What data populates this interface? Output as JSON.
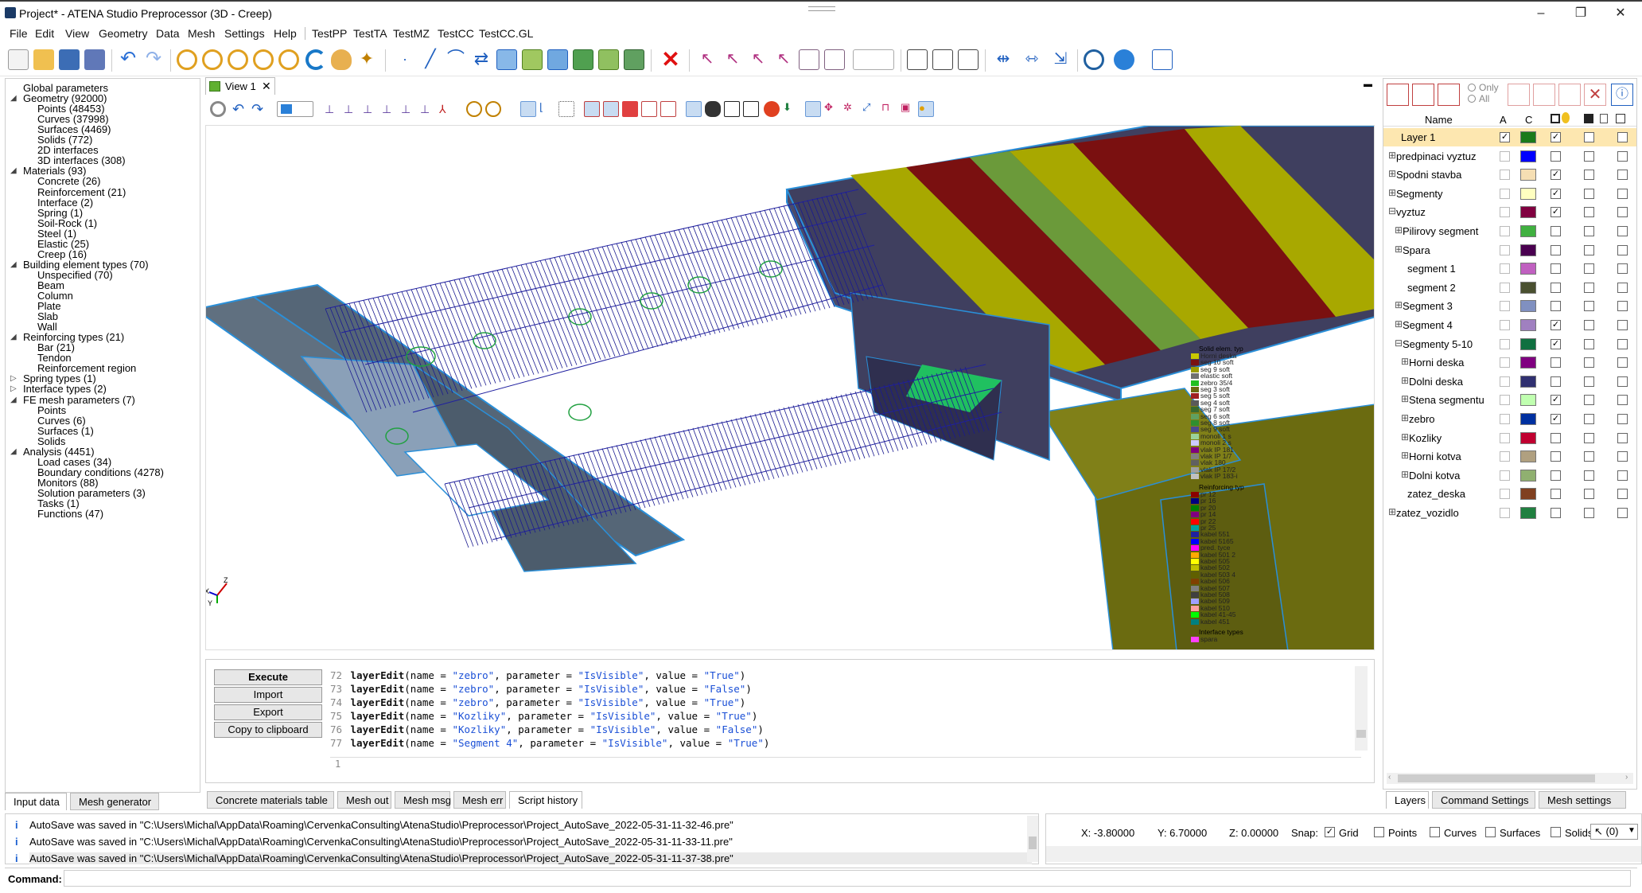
{
  "window": {
    "title": "Project* - ATENA Studio Preprocessor (3D - Creep)",
    "minimize": "–",
    "maximize": "❐",
    "close": "✕"
  },
  "menu": [
    "File",
    "Edit",
    "View",
    "Geometry",
    "Data",
    "Mesh",
    "Settings",
    "Help",
    "TestPP",
    "TestTA",
    "TestMZ",
    "TestCC",
    "TestCC.GL"
  ],
  "tree": [
    {
      "label": "Global parameters",
      "level": 0,
      "toggle": ""
    },
    {
      "label": "Geometry (92000)",
      "level": 0,
      "toggle": "◢"
    },
    {
      "label": "Points (48453)",
      "level": 1,
      "toggle": ""
    },
    {
      "label": "Curves (37998)",
      "level": 1,
      "toggle": ""
    },
    {
      "label": "Surfaces (4469)",
      "level": 1,
      "toggle": ""
    },
    {
      "label": "Solids (772)",
      "level": 1,
      "toggle": ""
    },
    {
      "label": "2D interfaces",
      "level": 1,
      "toggle": ""
    },
    {
      "label": "3D interfaces (308)",
      "level": 1,
      "toggle": ""
    },
    {
      "label": "Materials (93)",
      "level": 0,
      "toggle": "◢"
    },
    {
      "label": "Concrete (26)",
      "level": 1,
      "toggle": ""
    },
    {
      "label": "Reinforcement (21)",
      "level": 1,
      "toggle": ""
    },
    {
      "label": "Interface (2)",
      "level": 1,
      "toggle": ""
    },
    {
      "label": "Spring (1)",
      "level": 1,
      "toggle": ""
    },
    {
      "label": "Soil-Rock (1)",
      "level": 1,
      "toggle": ""
    },
    {
      "label": "Steel (1)",
      "level": 1,
      "toggle": ""
    },
    {
      "label": "Elastic (25)",
      "level": 1,
      "toggle": ""
    },
    {
      "label": "Creep (16)",
      "level": 1,
      "toggle": ""
    },
    {
      "label": "Building element types (70)",
      "level": 0,
      "toggle": "◢"
    },
    {
      "label": "Unspecified  (70)",
      "level": 1,
      "toggle": ""
    },
    {
      "label": "Beam",
      "level": 1,
      "toggle": ""
    },
    {
      "label": "Column",
      "level": 1,
      "toggle": ""
    },
    {
      "label": "Plate",
      "level": 1,
      "toggle": ""
    },
    {
      "label": "Slab",
      "level": 1,
      "toggle": ""
    },
    {
      "label": "Wall",
      "level": 1,
      "toggle": ""
    },
    {
      "label": "Reinforcing types  (21)",
      "level": 0,
      "toggle": "◢"
    },
    {
      "label": "Bar  (21)",
      "level": 1,
      "toggle": ""
    },
    {
      "label": "Tendon",
      "level": 1,
      "toggle": ""
    },
    {
      "label": "Reinforcement region",
      "level": 1,
      "toggle": ""
    },
    {
      "label": "Spring types  (1)",
      "level": 0,
      "toggle": "▷"
    },
    {
      "label": "Interface types  (2)",
      "level": 0,
      "toggle": "▷"
    },
    {
      "label": "FE mesh parameters (7)",
      "level": 0,
      "toggle": "◢"
    },
    {
      "label": "Points",
      "level": 1,
      "toggle": ""
    },
    {
      "label": "Curves (6)",
      "level": 1,
      "toggle": ""
    },
    {
      "label": "Surfaces (1)",
      "level": 1,
      "toggle": ""
    },
    {
      "label": "Solids",
      "level": 1,
      "toggle": ""
    },
    {
      "label": "Analysis (4451)",
      "level": 0,
      "toggle": "◢"
    },
    {
      "label": "Load cases (34)",
      "level": 1,
      "toggle": ""
    },
    {
      "label": "Boundary conditions (4278)",
      "level": 1,
      "toggle": ""
    },
    {
      "label": "Monitors (88)",
      "level": 1,
      "toggle": ""
    },
    {
      "label": "Solution parameters (3)",
      "level": 1,
      "toggle": ""
    },
    {
      "label": "Tasks (1)",
      "level": 1,
      "toggle": ""
    },
    {
      "label": "Functions (47)",
      "level": 1,
      "toggle": ""
    }
  ],
  "left_tabs": [
    "Input data",
    "Mesh generator"
  ],
  "view_tab": {
    "label": "View 1",
    "close": "✕"
  },
  "axis_labels": {
    "x": "X",
    "y": "Y",
    "z": "Z"
  },
  "legend": {
    "elem_header": "Solid elem. typ",
    "elem_items": [
      {
        "label": "Horni deska",
        "color": "#c8c800"
      },
      {
        "label": "seg 10 soft",
        "color": "#7a1010"
      },
      {
        "label": "seg 9 soft",
        "color": "#9b9b00"
      },
      {
        "label": "elastic soft",
        "color": "#707070"
      },
      {
        "label": "zebro 35/4",
        "color": "#20c020"
      },
      {
        "label": "seg 3 soft",
        "color": "#6b6b10"
      },
      {
        "label": "seg 5 soft",
        "color": "#a02020"
      },
      {
        "label": "seg 4 soft",
        "color": "#5a5a5a"
      },
      {
        "label": "seg 7 soft",
        "color": "#3a6a30"
      },
      {
        "label": "seg 6 soft",
        "color": "#60a060"
      },
      {
        "label": "seg 8 soft",
        "color": "#2f8f2f"
      },
      {
        "label": "seg 9 soft",
        "color": "#4a4a90"
      },
      {
        "label": "monoli 1 s",
        "color": "#9bd29b"
      },
      {
        "label": "monoli 2 s",
        "color": "#ccccff"
      },
      {
        "label": "vlak IP 181",
        "color": "#800080"
      },
      {
        "label": "vlak IP 1/7",
        "color": "#808080"
      },
      {
        "label": "vlak 180",
        "color": "#606060"
      },
      {
        "label": "vlak IP 17/2",
        "color": "#a0a0a0"
      },
      {
        "label": "vlak IP 183-i",
        "color": "#c0c0c0"
      }
    ],
    "reinf_header": "Reinforcing typ",
    "reinf_items": [
      {
        "label": "pr 12",
        "color": "#8b0000"
      },
      {
        "label": "pr 16",
        "color": "#000080"
      },
      {
        "label": "pr 20",
        "color": "#008000"
      },
      {
        "label": "pr 14",
        "color": "#800080"
      },
      {
        "label": "pr 22",
        "color": "#ff0000"
      },
      {
        "label": "pr 25",
        "color": "#00a0a0"
      },
      {
        "label": "kabel 551",
        "color": "#2020a0"
      },
      {
        "label": "kabel 5165",
        "color": "#0000ff"
      },
      {
        "label": "pred. tyce",
        "color": "#ff00ff"
      },
      {
        "label": "kabel 501 2",
        "color": "#ffaa00"
      },
      {
        "label": "kabel 505",
        "color": "#ffff00"
      },
      {
        "label": "kabel 502",
        "color": "#c0c000"
      },
      {
        "label": "kabel 503 4",
        "color": "#606000"
      },
      {
        "label": "kabel 506",
        "color": "#804000"
      },
      {
        "label": "kabel 507",
        "color": "#808080"
      },
      {
        "label": "kabel 508",
        "color": "#404040"
      },
      {
        "label": "kabel 509",
        "color": "#a0a0ff"
      },
      {
        "label": "kabel 510",
        "color": "#ffa0a0"
      },
      {
        "label": "kabel 41-45",
        "color": "#00ff00"
      },
      {
        "label": "kabel 451",
        "color": "#008080"
      }
    ],
    "iface_header": "Interface types",
    "iface_items": [
      {
        "label": "spara",
        "color": "#ff40ff"
      }
    ]
  },
  "script": {
    "buttons": [
      "Execute",
      "Import",
      "Export",
      "Copy to clipboard"
    ],
    "lines": [
      {
        "n": "72",
        "name": "zebro",
        "param": "IsVisible",
        "value": "True"
      },
      {
        "n": "73",
        "name": "zebro",
        "param": "IsVisible",
        "value": "False"
      },
      {
        "n": "74",
        "name": "zebro",
        "param": "IsVisible",
        "value": "True"
      },
      {
        "n": "75",
        "name": "Kozliky",
        "param": "IsVisible",
        "value": "True"
      },
      {
        "n": "76",
        "name": "Kozliky",
        "param": "IsVisible",
        "value": "False"
      },
      {
        "n": "77",
        "name": "Segment 4",
        "param": "IsVisible",
        "value": "True"
      }
    ],
    "fn": "layerEdit",
    "input_line_no": "1"
  },
  "mid_tabs": [
    "Concrete materials table",
    "Mesh out",
    "Mesh msg",
    "Mesh err",
    "Script history"
  ],
  "layers": {
    "only_label": "Only",
    "all_label": "All",
    "headers": {
      "name": "Name",
      "a": "A",
      "c": "C"
    },
    "rows": [
      {
        "name": "Layer 1",
        "indent": 0,
        "exp": "",
        "color": "#1a7a1a",
        "a": true,
        "v": true,
        "selected": true
      },
      {
        "name": "predpinaci vyztuz",
        "indent": 0,
        "exp": "⊞",
        "color": "#0000ff",
        "a": false,
        "v": false
      },
      {
        "name": "Spodni stavba",
        "indent": 0,
        "exp": "⊞",
        "color": "#f5deb3",
        "a": false,
        "v": true
      },
      {
        "name": "Segmenty",
        "indent": 0,
        "exp": "⊞",
        "color": "#ffffc0",
        "a": false,
        "v": true
      },
      {
        "name": "vyztuz",
        "indent": 0,
        "exp": "⊟",
        "color": "#800040",
        "a": false,
        "v": true
      },
      {
        "name": "Pilirovy segment",
        "indent": 1,
        "exp": "⊞",
        "color": "#40b040",
        "a": false,
        "v": false
      },
      {
        "name": "Spara",
        "indent": 1,
        "exp": "⊞",
        "color": "#4a0050",
        "a": false,
        "v": false
      },
      {
        "name": "segment 1",
        "indent": 1,
        "exp": "",
        "color": "#c060c0",
        "a": false,
        "v": false
      },
      {
        "name": "segment 2",
        "indent": 1,
        "exp": "",
        "color": "#4a5030",
        "a": false,
        "v": false
      },
      {
        "name": "Segment 3",
        "indent": 1,
        "exp": "⊞",
        "color": "#8090c0",
        "a": false,
        "v": false
      },
      {
        "name": "Segment 4",
        "indent": 1,
        "exp": "⊞",
        "color": "#a080c0",
        "a": false,
        "v": true
      },
      {
        "name": "Segmenty 5-10",
        "indent": 1,
        "exp": "⊟",
        "color": "#107040",
        "a": false,
        "v": true
      },
      {
        "name": "Horni deska",
        "indent": 2,
        "exp": "⊞",
        "color": "#800080",
        "a": false,
        "v": false
      },
      {
        "name": "Dolni deska",
        "indent": 2,
        "exp": "⊞",
        "color": "#303070",
        "a": false,
        "v": false
      },
      {
        "name": "Stena segmentu",
        "indent": 2,
        "exp": "⊞",
        "color": "#c0ffb0",
        "a": false,
        "v": true
      },
      {
        "name": "zebro",
        "indent": 2,
        "exp": "⊞",
        "color": "#0030a0",
        "a": false,
        "v": true
      },
      {
        "name": "Kozliky",
        "indent": 2,
        "exp": "⊞",
        "color": "#c00030",
        "a": false,
        "v": false
      },
      {
        "name": "Horni kotva",
        "indent": 2,
        "exp": "⊞",
        "color": "#b0a080",
        "a": false,
        "v": false
      },
      {
        "name": "Dolni kotva",
        "indent": 2,
        "exp": "⊞",
        "color": "#90b070",
        "a": false,
        "v": false
      },
      {
        "name": "zatez_deska",
        "indent": 1,
        "exp": "",
        "color": "#804020",
        "a": false,
        "v": false
      },
      {
        "name": "zatez_vozidlo",
        "indent": 0,
        "exp": "⊞",
        "color": "#208040",
        "a": false,
        "v": false
      }
    ]
  },
  "right_tabs": [
    "Layers",
    "Command Settings",
    "Mesh settings"
  ],
  "log": [
    "AutoSave was saved in \"C:\\Users\\Michal\\AppData\\Roaming\\CervenkaConsulting\\AtenaStudio\\Preprocessor\\Project_AutoSave_2022-05-31-11-32-46.pre\"",
    "AutoSave was saved in \"C:\\Users\\Michal\\AppData\\Roaming\\CervenkaConsulting\\AtenaStudio\\Preprocessor\\Project_AutoSave_2022-05-31-11-33-11.pre\"",
    "AutoSave was saved in \"C:\\Users\\Michal\\AppData\\Roaming\\CervenkaConsulting\\AtenaStudio\\Preprocessor\\Project_AutoSave_2022-05-31-11-37-38.pre\""
  ],
  "status": {
    "x": "X: -3.80000",
    "y": "Y: 6.70000",
    "z": "Z: 0.00000",
    "snap": "Snap:",
    "snap_items": [
      {
        "label": "Grid",
        "checked": true
      },
      {
        "label": "Points",
        "checked": false
      },
      {
        "label": "Curves",
        "checked": false
      },
      {
        "label": "Surfaces",
        "checked": false
      },
      {
        "label": "Solids",
        "checked": false
      }
    ],
    "cursor": "↖ (0)"
  },
  "command": {
    "label": "Command:",
    "value": ""
  },
  "toolbar_icons": [
    "new-file-icon",
    "open-folder-icon",
    "save-icon",
    "save-all-icon",
    "undo-icon",
    "redo-icon",
    "zoom-in-icon",
    "zoom-out-icon",
    "zoom-window-icon",
    "zoom-all-icon",
    "zoom-selection-icon",
    "rotate-icon",
    "pan-icon",
    "select-tool-icon",
    "point-icon",
    "line-icon",
    "arc-icon",
    "polyline-icon",
    "surface-icon",
    "surface-from-curves-icon",
    "solid-icon",
    "extrude-icon",
    "copy-icon",
    "mirror-icon",
    "delete-icon",
    "select-points-icon",
    "select-curves-icon",
    "select-surfaces-icon",
    "select-solids-icon",
    "select-interfaces-icon",
    "snap-icon",
    "group-icon",
    "transform-icon",
    "move-icon",
    "split-icon",
    "merge-icon",
    "align-icon",
    "settings-gear-icon",
    "mesh-settings-icon",
    "script-icon"
  ]
}
